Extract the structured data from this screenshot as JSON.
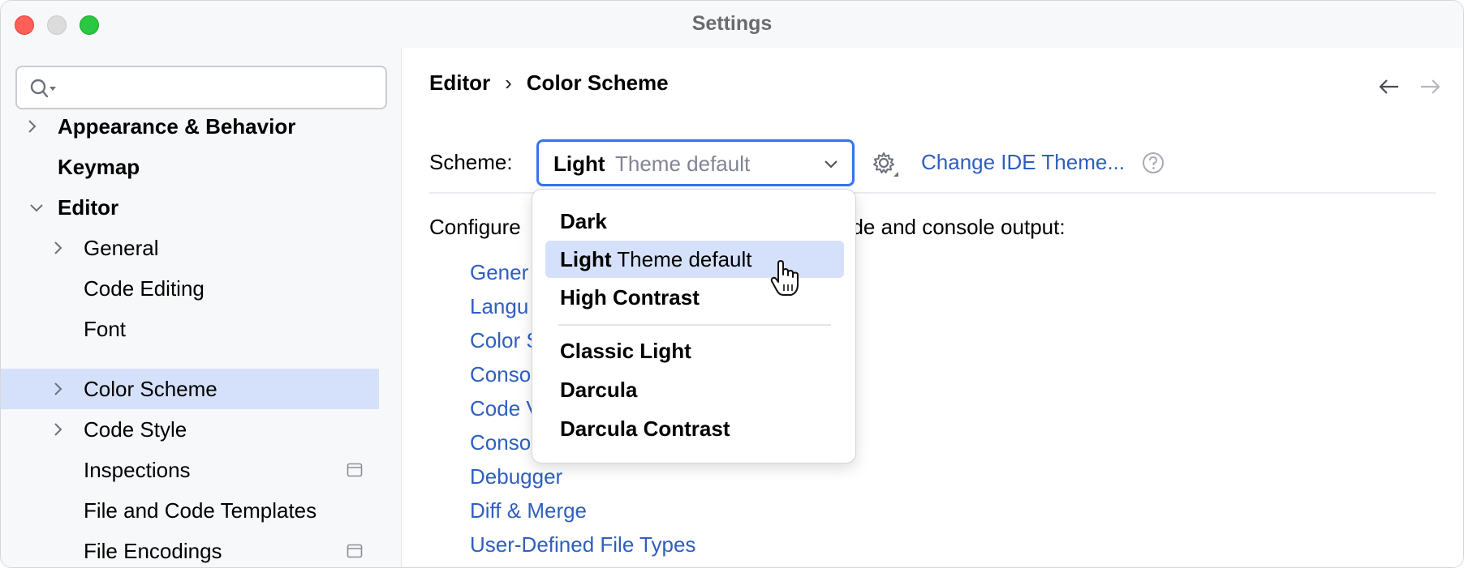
{
  "window": {
    "title": "Settings"
  },
  "search": {
    "placeholder": ""
  },
  "sidebar": {
    "items": [
      {
        "label": "Appearance & Behavior"
      },
      {
        "label": "Keymap"
      },
      {
        "label": "Editor"
      },
      {
        "label": "General"
      },
      {
        "label": "Code Editing"
      },
      {
        "label": "Font"
      },
      {
        "label": "Color Scheme"
      },
      {
        "label": "Code Style"
      },
      {
        "label": "Inspections"
      },
      {
        "label": "File and Code Templates"
      },
      {
        "label": "File Encodings"
      }
    ]
  },
  "breadcrumb": {
    "parent": "Editor",
    "separator": "›",
    "current": "Color Scheme"
  },
  "scheme": {
    "label": "Scheme:",
    "selected_name": "Light",
    "selected_suffix": "Theme default",
    "change_theme_link": "Change IDE Theme..."
  },
  "configure_text": "Configure",
  "configure_text_tail": "ode and console output:",
  "links": {
    "general_partial": "Gener",
    "language_partial": "Langu",
    "color_scheme_partial": "Color S",
    "console_partial": "Conso",
    "code_partial": "Code V",
    "console2_partial": "Conso",
    "debugger": "Debugger",
    "diff_merge": "Diff & Merge",
    "user_defined": "User-Defined File Types"
  },
  "dropdown": {
    "options": [
      {
        "name": "Dark",
        "suffix": ""
      },
      {
        "name": "Light",
        "suffix": "Theme default"
      },
      {
        "name": "High Contrast",
        "suffix": ""
      },
      {
        "name": "Classic Light",
        "suffix": ""
      },
      {
        "name": "Darcula",
        "suffix": ""
      },
      {
        "name": "Darcula Contrast",
        "suffix": ""
      }
    ],
    "selected_index": 1
  },
  "colors": {
    "accent": "#3574f0",
    "link": "#2f5fbf",
    "selection": "#d5e1fa",
    "sidebar_bg": "#f7f8fa"
  }
}
